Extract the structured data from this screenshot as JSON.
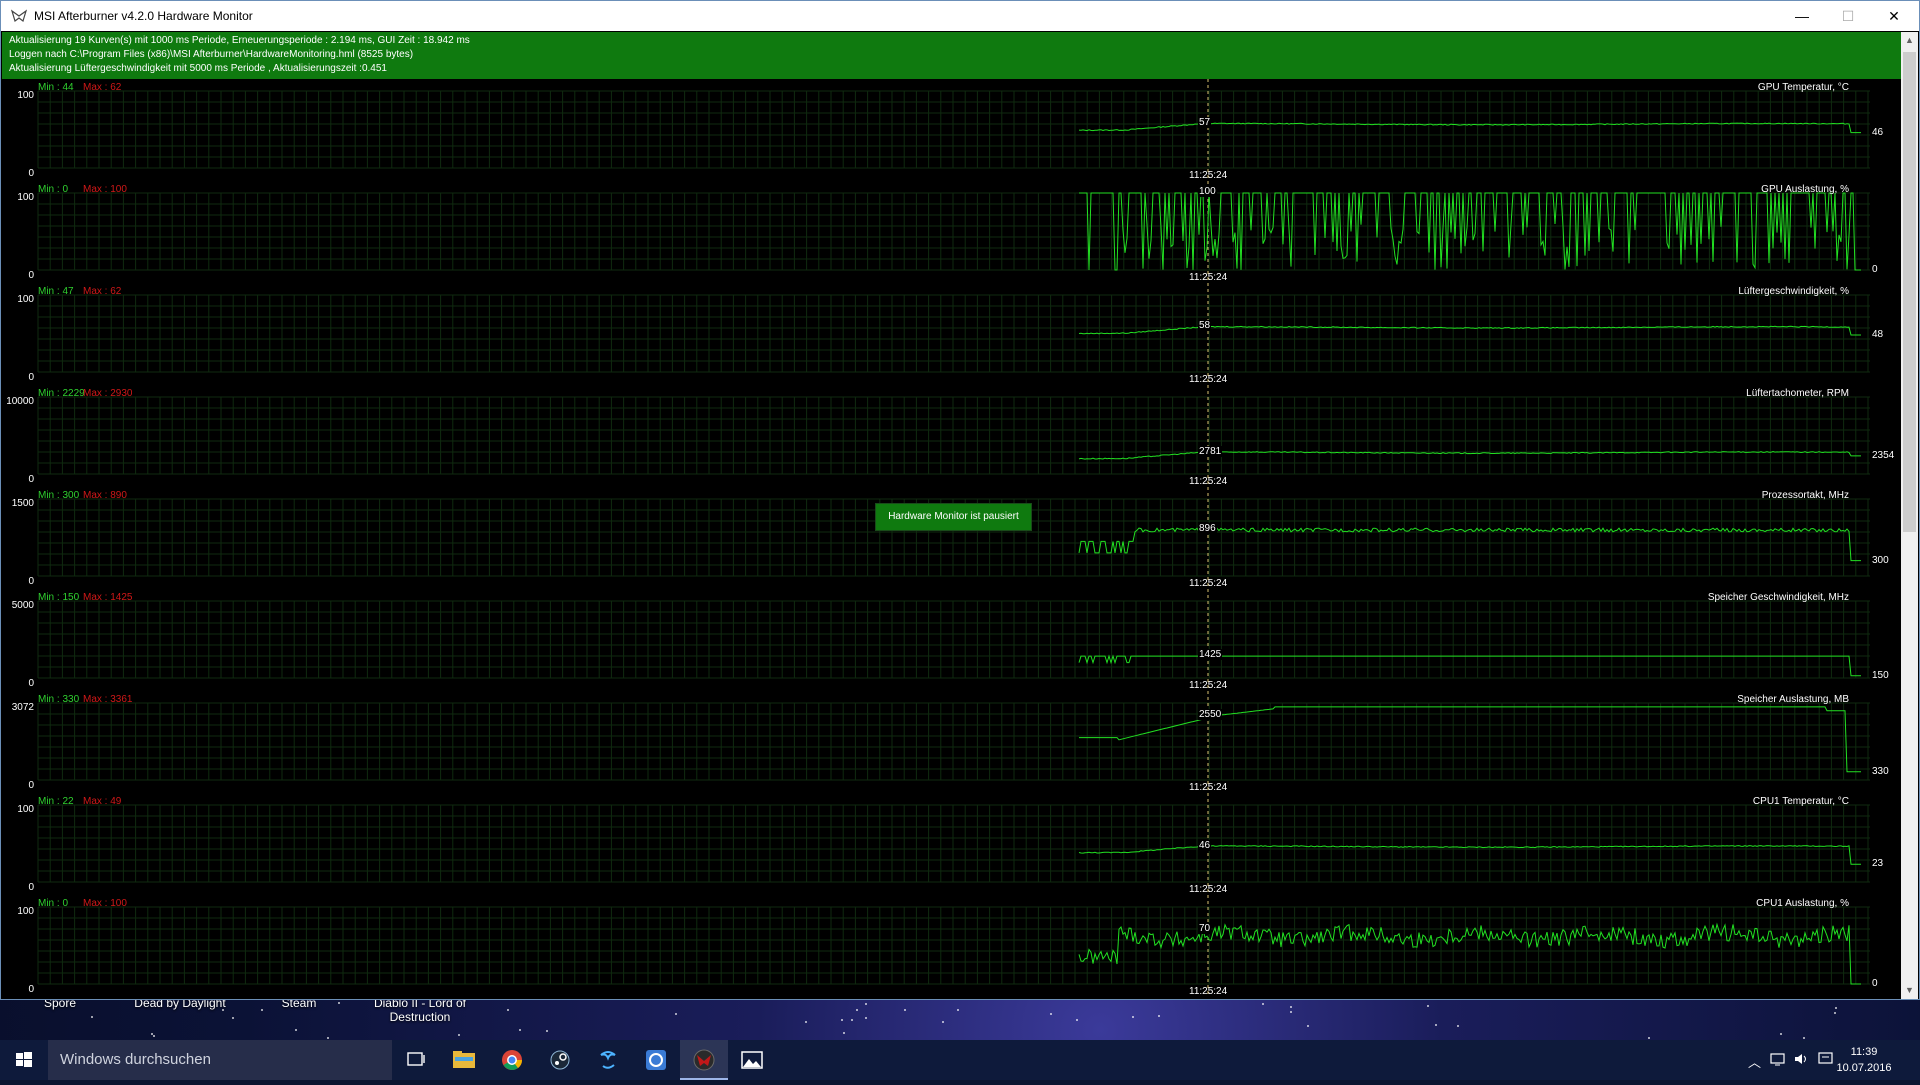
{
  "window": {
    "title": "MSI Afterburner v4.2.0 Hardware Monitor",
    "minimize": "—",
    "maximize": "☐",
    "close": "✕"
  },
  "info": {
    "line1": "Aktualisierung 19 Kurven(s) mit 1000 ms Periode, Erneuerungsperiode : 2.194 ms, GUI Zeit : 18.942 ms",
    "line2": "Loggen nach C:\\Program Files (x86)\\MSI Afterburner\\HardwareMonitoring.hml (8525 bytes)",
    "line3": "Aktualisierung Lüftergeschwindigkeit mit 5000 ms Periode , Aktualisierungszeit :0.451"
  },
  "paused_badge": "Hardware Monitor ist pausiert",
  "colors": {
    "line": "#22e022",
    "grid": "#0f2a0f",
    "info_bg": "#0f7a0f",
    "min_text": "#2fd12f",
    "max_text": "#d01818"
  },
  "graphs": [
    {
      "min": "Min : 44",
      "max": "Max : 62",
      "title": "GPU Temperatur, °C",
      "ytop": "100",
      "ybot": "0",
      "cur": "57",
      "time": "11:25:24",
      "end": "46",
      "level": 0.57,
      "endlevel": 0.46,
      "style": "smooth"
    },
    {
      "min": "Min : 0",
      "max": "Max : 100",
      "title": "GPU Auslastung, %",
      "ytop": "100",
      "ybot": "0",
      "cur": "100",
      "time": "11:25:24",
      "end": "0",
      "level": 1.0,
      "endlevel": 0.0,
      "style": "spiky"
    },
    {
      "min": "Min : 47",
      "max": "Max : 62",
      "title": "Lüftergeschwindigkeit, %",
      "ytop": "100",
      "ybot": "0",
      "cur": "58",
      "time": "11:25:24",
      "end": "48",
      "level": 0.58,
      "endlevel": 0.48,
      "style": "smooth"
    },
    {
      "min": "Min : 2229",
      "max": "Max : 2930",
      "title": "Lüftertachometer, RPM",
      "ytop": "10000",
      "ybot": "0",
      "cur": "2781",
      "time": "11:25:24",
      "end": "2354",
      "level": 0.2781,
      "endlevel": 0.2354,
      "style": "smooth"
    },
    {
      "min": "Min : 300",
      "max": "Max : 890",
      "title": "Prozessortakt, MHz",
      "ytop": "1500",
      "ybot": "0",
      "cur": "896",
      "time": "11:25:24",
      "end": "300",
      "level": 0.597,
      "endlevel": 0.2,
      "style": "clock"
    },
    {
      "min": "Min : 150",
      "max": "Max : 1425",
      "title": "Speicher Geschwindigkeit, MHz",
      "ytop": "5000",
      "ybot": "0",
      "cur": "1425",
      "time": "11:25:24",
      "end": "150",
      "level": 0.285,
      "endlevel": 0.03,
      "style": "mem"
    },
    {
      "min": "Min : 330",
      "max": "Max : 3361",
      "title": "Speicher Auslastung, MB",
      "ytop": "3072",
      "ybot": "0",
      "cur": "2550",
      "time": "11:25:24",
      "end": "330",
      "level": 0.83,
      "endlevel": 0.107,
      "style": "usage"
    },
    {
      "min": "Min : 22",
      "max": "Max : 49",
      "title": "CPU1 Temperatur, °C",
      "ytop": "100",
      "ybot": "0",
      "cur": "46",
      "time": "11:25:24",
      "end": "23",
      "level": 0.46,
      "endlevel": 0.23,
      "style": "smooth"
    },
    {
      "min": "Min : 0",
      "max": "Max : 100",
      "title": "CPU1 Auslastung, %",
      "ytop": "100",
      "ybot": "0",
      "cur": "70",
      "time": "11:25:24",
      "end": "0",
      "level": 0.7,
      "endlevel": 0.0,
      "style": "noisy"
    }
  ],
  "desktop_icons": [
    "Spore",
    "Dead by Daylight",
    "Steam",
    "Diablo II - Lord of Destruction"
  ],
  "taskbar": {
    "search_placeholder": "Windows durchsuchen",
    "apps": [
      "task-view-icon",
      "file-explorer-icon",
      "chrome-icon",
      "steam-icon",
      "blizzard-icon",
      "uplay-icon",
      "msi-afterburner-icon",
      "photos-icon"
    ],
    "time": "11:39",
    "date": "10.07.2016"
  }
}
